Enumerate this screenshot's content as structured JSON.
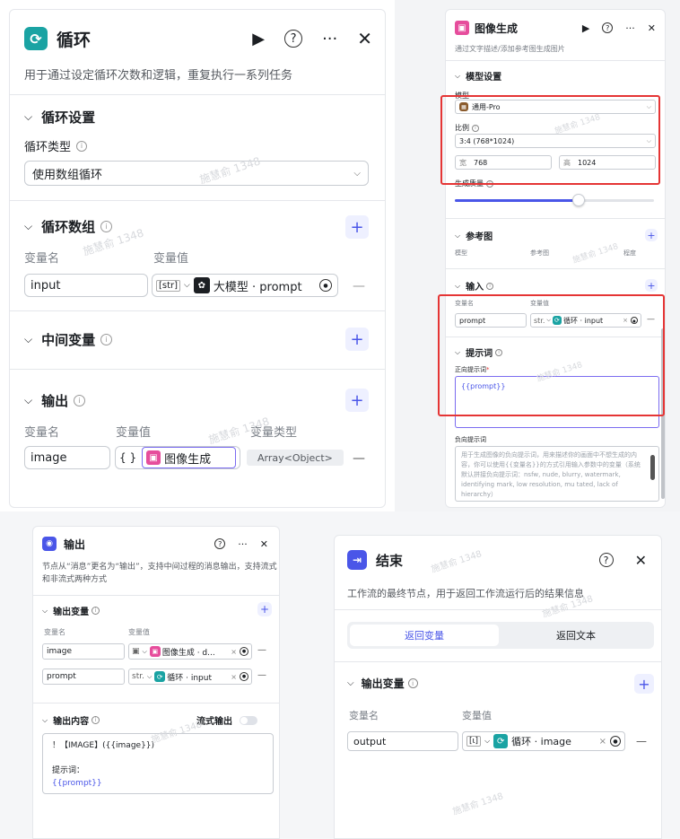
{
  "loop": {
    "title": "循环",
    "desc": "用于通过设定循环次数和逻辑，重复执行一系列任务",
    "settings_title": "循环设置",
    "loop_type_label": "循环类型",
    "loop_type_value": "使用数组循环",
    "array_title": "循环数组",
    "col_var_name": "变量名",
    "col_var_value": "变量值",
    "array_row": {
      "name": "input",
      "type": "[str]",
      "source": "大模型 · prompt"
    },
    "mid_title": "中间变量",
    "output_title": "输出",
    "col_var_type": "变量类型",
    "output_row": {
      "name": "image",
      "type_icon": "{ }",
      "source": "图像生成",
      "var_type": "Array<Object>"
    }
  },
  "image_gen": {
    "title": "图像生成",
    "desc": "通过文字描述/添加参考图生成图片",
    "model_settings_title": "模型设置",
    "model_label": "模型",
    "model_value": "通用-Pro",
    "ratio_label": "比例",
    "ratio_value": "3:4 (768*1024)",
    "width_label": "宽",
    "width_value": "768",
    "height_label": "高",
    "height_value": "1024",
    "quality_label": "生成质量",
    "quality_fraction": 0.62,
    "ref_title": "参考图",
    "ref_cols": [
      "模型",
      "参考图",
      "程度"
    ],
    "input_title": "输入",
    "input_col_name": "变量名",
    "input_col_value": "变量值",
    "input_row": {
      "name": "prompt",
      "type": "str.",
      "source": "循环 · input"
    },
    "prompt_title": "提示词",
    "positive_label": "正向提示词",
    "positive_value": "{{prompt}}",
    "negative_label": "负向提示词",
    "negative_placeholder": "用于生成图像的负向提示词，用来描述你的画面中不想生成的内容，你可以使用{{变量名}}的方式引用输入参数中的变量（系统默认拼接负向提示词：nsfw, nude, blurry, watermark, identifying mark, low resolution, mu tated, lack of hierarchy）"
  },
  "output_node": {
    "title": "输出",
    "desc": "节点从“消息”更名为“输出”，支持中间过程的消息输出，支持流式和非流式两种方式",
    "vars_title": "输出变量",
    "col_name": "变量名",
    "col_value": "变量值",
    "rows": [
      {
        "name": "image",
        "type": "▣",
        "source": "图像生成 · d..."
      },
      {
        "name": "prompt",
        "type": "str.",
        "source": "循环 · input"
      }
    ],
    "content_title": "输出内容",
    "stream_label": "流式输出",
    "content_line1": "！【IMAGE】({{image}})",
    "content_line2": "提示词：",
    "content_line3": "{{prompt}}"
  },
  "end_node": {
    "title": "结束",
    "desc": "工作流的最终节点，用于返回工作流运行后的结果信息",
    "tab_return_vars": "返回变量",
    "tab_return_text": "返回文本",
    "vars_title": "输出变量",
    "col_name": "变量名",
    "col_value": "变量值",
    "row": {
      "name": "output",
      "type": "[ι]",
      "source": "循环 · image"
    }
  },
  "watermark": "施慧俞 1348",
  "colors": {
    "accent": "#4a56e8",
    "loop": "#1aa3a3",
    "image": "#e64d9c",
    "highlight": "#e53535"
  }
}
